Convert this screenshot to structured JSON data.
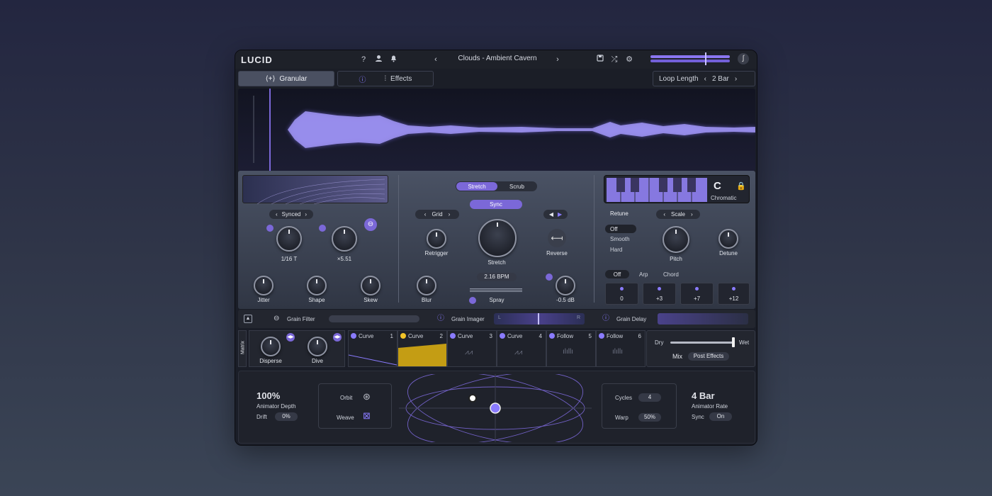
{
  "app": {
    "logo": "LUCID",
    "preset": "Clouds - Ambient Cavern",
    "help": "?"
  },
  "tabs": {
    "granular": "Granular",
    "effects": "Effects",
    "loop_label": "Loop Length",
    "loop_value": "2 Bar"
  },
  "left": {
    "mode": "Synced",
    "rate": "1/16 T",
    "mult": "×5.51",
    "jitter": "Jitter",
    "shape": "Shape",
    "skew": "Skew"
  },
  "center": {
    "stretch_tab": "Stretch",
    "scrub_tab": "Scrub",
    "sync": "Sync",
    "grid": "Grid",
    "retrigger": "Retrigger",
    "stretch": "Stretch",
    "reverse": "Reverse",
    "bpm": "2.16 BPM",
    "blur": "Blur",
    "spray": "Spray",
    "gain": "-0.5 dB"
  },
  "right": {
    "key": "C",
    "scale_name": "Chromatic",
    "retune": "Retune",
    "scale": "Scale",
    "off": "Off",
    "smooth": "Smooth",
    "hard": "Hard",
    "pitch": "Pitch",
    "detune": "Detune",
    "mode_off": "Off",
    "arp": "Arp",
    "chord": "Chord",
    "intervals": [
      "0",
      "+3",
      "+7",
      "+12"
    ]
  },
  "fx": {
    "grain_filter": "Grain Filter",
    "grain_imager": "Grain Imager",
    "grain_delay": "Grain Delay",
    "imager_l": "L",
    "imager_r": "R"
  },
  "matrix": {
    "label": "Matrix",
    "disperse": "Disperse",
    "dive": "Dive",
    "slots": [
      {
        "name": "Curve",
        "num": "1"
      },
      {
        "name": "Curve",
        "num": "2"
      },
      {
        "name": "Curve",
        "num": "3"
      },
      {
        "name": "Curve",
        "num": "4"
      },
      {
        "name": "Follow",
        "num": "5"
      },
      {
        "name": "Follow",
        "num": "6"
      }
    ],
    "dry": "Dry",
    "wet": "Wet",
    "mix": "Mix",
    "post": "Post Effects"
  },
  "animator": {
    "depth_val": "100%",
    "depth_label": "Animator Depth",
    "drift": "Drift",
    "drift_val": "0%",
    "orbit": "Orbit",
    "weave": "Weave",
    "cycles": "Cycles",
    "cycles_val": "4",
    "warp": "Warp",
    "warp_val": "50%",
    "rate_val": "4 Bar",
    "rate_label": "Animator Rate",
    "sync": "Sync",
    "sync_val": "On"
  },
  "colors": {
    "accent": "#7b68d8",
    "curve2": "#f2c428",
    "wave": "#8a7bff"
  }
}
